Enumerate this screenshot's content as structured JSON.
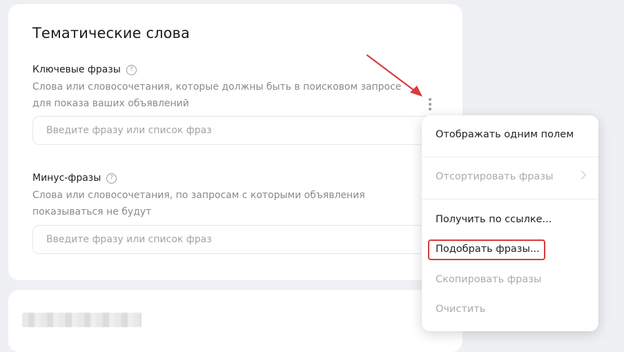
{
  "section": {
    "title": "Тематические слова"
  },
  "keywords": {
    "label": "Ключевые фразы",
    "description": "Слова или словосочетания, которые должны быть в поисковом запросе для показа ваших объявлений",
    "placeholder": "Введите фразу или список фраз"
  },
  "negative": {
    "label": "Минус-фразы",
    "description": "Слова или словосочетания, по запросам с которыми объявления показываться не будут",
    "placeholder": "Введите фразу или список фраз"
  },
  "icons": {
    "help": "help-circle-icon",
    "more": "more-vertical-icon",
    "submenu": "chevron-right-icon"
  },
  "menu": {
    "single_field": "Отображать одним полем",
    "sort": "Отсортировать фразы",
    "by_link": "Получить по ссылке...",
    "pick": "Подобрать фразы...",
    "copy": "Скопировать фразы",
    "clear": "Очистить"
  },
  "colors": {
    "background": "#eef0f4",
    "card": "#ffffff",
    "annotation": "#d93b3b",
    "muted_text": "#8a8a8a",
    "disabled_text": "#ababab"
  }
}
